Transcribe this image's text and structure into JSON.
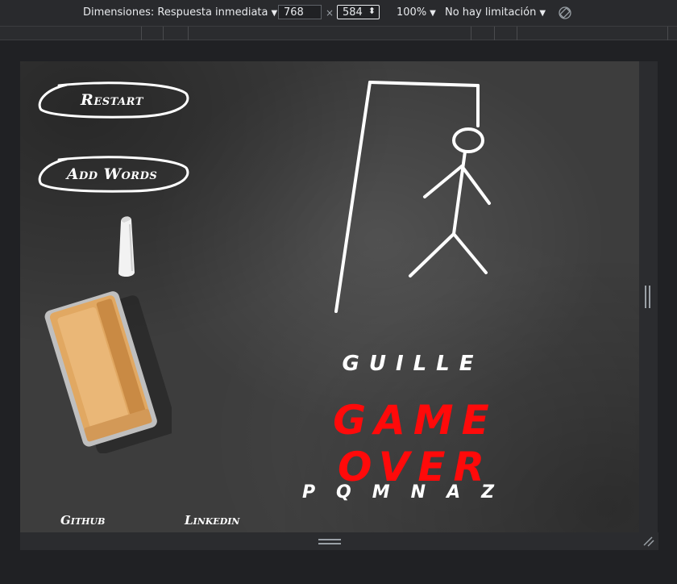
{
  "devtools": {
    "dimensions_label": "Dimensiones: Respuesta inmediata",
    "width_value": "768",
    "times_sign": "×",
    "height_value": "584",
    "zoom_label": "100%",
    "throttle_label": "No hay limitación",
    "caret": "▼",
    "spinner": "⬍"
  },
  "game": {
    "restart_label": "Restart",
    "add_words_label": "Add Words",
    "word": "GUILLE",
    "status": "GAME OVER",
    "wrong_letters": "PQMNAZ",
    "status_color": "#ff0a0a",
    "chalk_color": "#ffffff",
    "board_color": "#3d3d3d"
  },
  "footer": {
    "github_label": "Github",
    "linkedin_label": "Linkedin"
  }
}
